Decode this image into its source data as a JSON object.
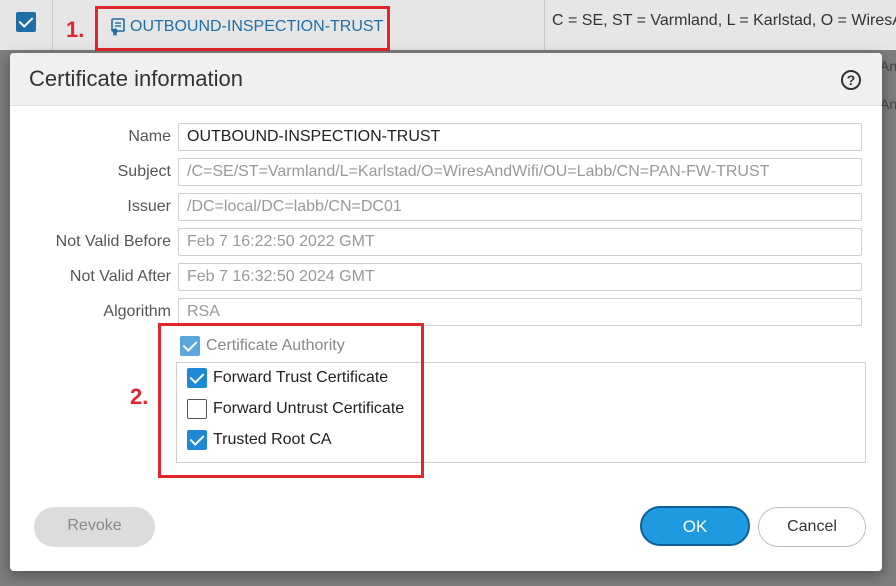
{
  "background": {
    "row_name": "OUTBOUND-INSPECTION-TRUST",
    "row_subject": "C = SE, ST = Varmland, L = Karlstad, O = WiresAnd",
    "peek_1": "An",
    "peek_2": "An"
  },
  "annotations": {
    "label_1": "1.",
    "label_2": "2."
  },
  "dialog": {
    "title": "Certificate information",
    "help_icon_glyph": "?",
    "fields": [
      {
        "label": "Name",
        "value": "OUTBOUND-INSPECTION-TRUST"
      },
      {
        "label": "Subject",
        "value": "/C=SE/ST=Varmland/L=Karlstad/O=WiresAndWifi/OU=Labb/CN=PAN-FW-TRUST"
      },
      {
        "label": "Issuer",
        "value": "/DC=local/DC=labb/CN=DC01"
      },
      {
        "label": "Not Valid Before",
        "value": "Feb  7 16:22:50 2022 GMT"
      },
      {
        "label": "Not Valid After",
        "value": "Feb  7 16:32:50 2024 GMT"
      },
      {
        "label": "Algorithm",
        "value": "RSA"
      }
    ],
    "certificate_authority": {
      "label": "Certificate Authority",
      "checked": true
    },
    "options": [
      {
        "label": "Forward Trust Certificate",
        "checked": true
      },
      {
        "label": "Forward Untrust Certificate",
        "checked": false
      },
      {
        "label": "Trusted Root CA",
        "checked": true
      }
    ],
    "buttons": {
      "revoke": "Revoke",
      "ok": "OK",
      "cancel": "Cancel"
    }
  },
  "colors": {
    "accent_blue": "#1e8ad6",
    "annotation_red": "#e3262b",
    "link_blue": "#1e6fa8"
  }
}
